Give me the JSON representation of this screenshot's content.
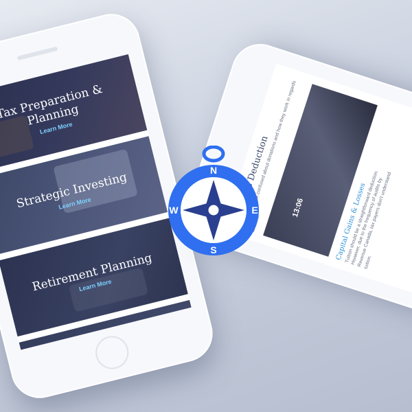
{
  "left_phone": {
    "cards": [
      {
        "title": "Tax Preparation & Planning",
        "link": "Learn More"
      },
      {
        "title": "Strategic Investing",
        "link": "Learn More"
      },
      {
        "title": "Retirement Planning",
        "link": "Learn More"
      }
    ]
  },
  "right_phone": {
    "heading": "Donations Deduction",
    "intro_text": "Some clients ask confused about donations and how they work in regards to taxes.",
    "photo_clock": "13:06",
    "subheading": "Capital Gains & Losses",
    "body_lines": [
      "Tuition should be a straightforward deduction.",
      "However, due to the frequency of audits by",
      "Revenue Canada, tax payers don't understand",
      "tuition."
    ]
  },
  "compass": {
    "north": "N",
    "east": "E",
    "south": "S",
    "west": "W",
    "badge_color": "#2f6ff0",
    "needle_color": "#2a3f8f"
  }
}
